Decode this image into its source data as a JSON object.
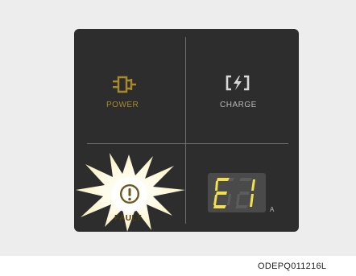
{
  "panel": {
    "power": {
      "label": "POWER",
      "icon": "plug-icon",
      "color": "#a78a2c"
    },
    "charge": {
      "label": "CHARGE",
      "icon": "battery-charge-icon",
      "color": "#b8b8b8"
    },
    "fault": {
      "label": "FAULT",
      "icon": "exclamation-circle-icon",
      "lit": true
    },
    "display": {
      "value": "E1",
      "unit": "A",
      "color": "#f2e04a"
    }
  },
  "caption": "ODEPQ011216L"
}
